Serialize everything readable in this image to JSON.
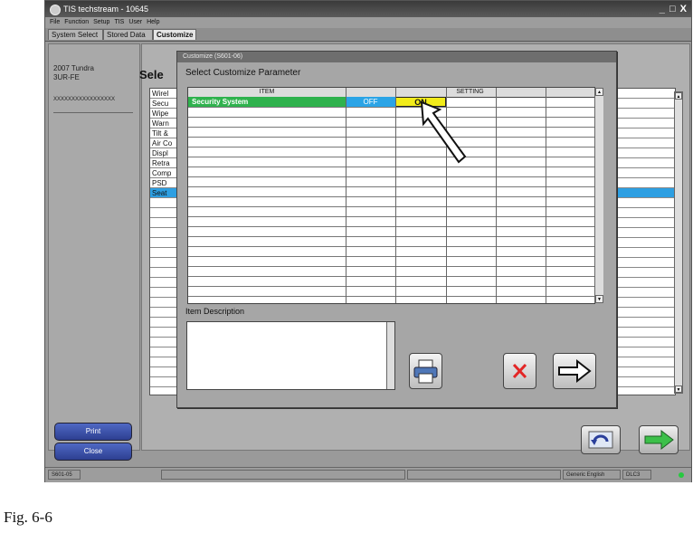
{
  "window": {
    "title": "TIS techstream - 10645",
    "controls": "_ □ X"
  },
  "menu": [
    "File",
    "Function",
    "Setup",
    "TIS",
    "User",
    "Help"
  ],
  "tabs": [
    "System Select",
    "Stored Data",
    "Customize"
  ],
  "vehicle": {
    "model": "2007 Tundra",
    "engine": "3UR-FE",
    "vin": "XXXXXXXXXXXXXXXXX"
  },
  "left_buttons": {
    "print": "Print",
    "close": "Close"
  },
  "main": {
    "heading": "Sele",
    "list": [
      "Wirel",
      "Secu",
      "Wipe",
      "Warn",
      "Tilt &",
      "Air Co",
      "Displ",
      "Retra",
      "Comp",
      "PSD",
      "Seat"
    ]
  },
  "dialog": {
    "title": "Customize (S601-06)",
    "heading": "Select Customize Parameter",
    "col_item": "ITEM",
    "col_setting": "SETTING",
    "row": {
      "item": "Security System",
      "off": "OFF",
      "on": "ON"
    },
    "desc_label": "Item Description"
  },
  "status": {
    "code": "S601-05",
    "language": "Generic English",
    "port": "DLC3"
  },
  "caption": "Fig. 6-6",
  "colors": {
    "selected_item": "#2fb24d",
    "off_cell": "#2ba4e6",
    "on_cell": "#f2ec1a",
    "cancel_x": "#e32626",
    "next_arrow": "#3cc04a"
  },
  "icons": [
    "printer-icon",
    "cancel-x-icon",
    "next-arrow-icon",
    "back-icon",
    "green-arrow-icon"
  ]
}
